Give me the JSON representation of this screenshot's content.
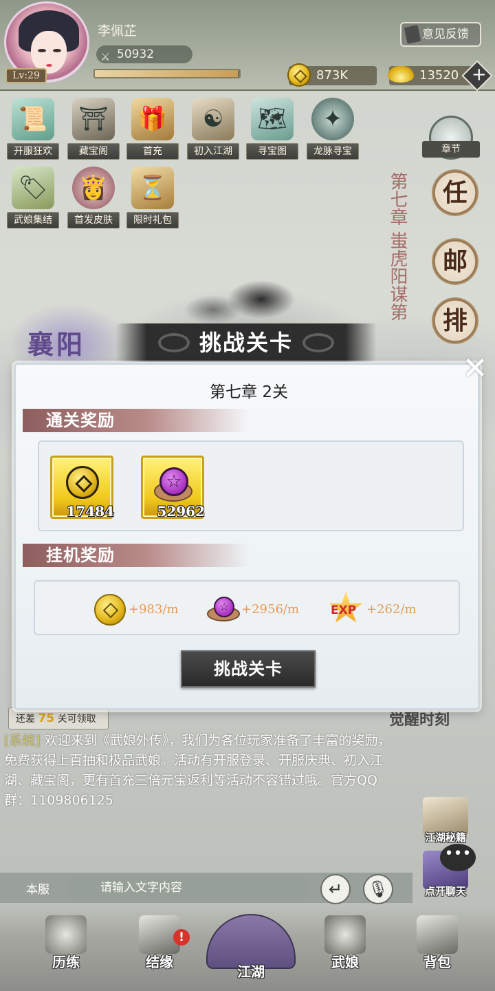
{
  "player": {
    "name": "李佩芷",
    "level": "Lv:29",
    "power": "50932",
    "exp_progress": 0.99
  },
  "header": {
    "feedback_label": "意见反馈",
    "gold": "873K",
    "ingot": "13520"
  },
  "activities": [
    {
      "label": "开服狂欢"
    },
    {
      "label": "藏宝阁"
    },
    {
      "label": "首充"
    },
    {
      "label": "初入江湖"
    },
    {
      "label": "寻宝图"
    },
    {
      "label": "龙脉寻宝"
    },
    {
      "label": "武娘集结"
    },
    {
      "label": "首发皮肤"
    },
    {
      "label": "限时礼包"
    }
  ],
  "side": {
    "chapter_label": "章节",
    "buttons": [
      "任",
      "邮",
      "排"
    ],
    "vertical_title": "第七章 蚩虎阳谋第"
  },
  "stage": {
    "banner_title": "挑战关卡",
    "region_text": "襄阳"
  },
  "modal": {
    "title": "第七章  2关",
    "clear_reward_header": "通关奖励",
    "clear_rewards": [
      {
        "icon": "gold-coin",
        "count": "17484"
      },
      {
        "icon": "purple-gem",
        "count": "52962"
      }
    ],
    "idle_reward_header": "挂机奖励",
    "idle_rewards": [
      {
        "icon": "gold-coin",
        "value": "+983/m"
      },
      {
        "icon": "purple-gem",
        "value": "+2956/m"
      },
      {
        "icon": "exp-star",
        "value": "+262/m",
        "icon_text": "EXP"
      }
    ],
    "challenge_label": "挑战关卡",
    "close_glyph": "✕"
  },
  "progress_hint": {
    "prefix": "还差",
    "number": "7",
    "number2": "5",
    "suffix": "关可领取"
  },
  "right_panel_text": "觉醒时刻",
  "chat": {
    "tag": "[系统]",
    "message": "欢迎来到《武娘外传》，我们为各位玩家准备了丰富的奖励，免费获得上百抽和极品武娘。活动有开服登录、开服庆典、初入江湖、藏宝阁，更有首充三倍元宝返利等活动不容错过哦。官方QQ群：1109806125",
    "server_label": "本服",
    "input_placeholder": "请输入文字内容",
    "secrets_label": "江湖秘籍",
    "open_chat_label": "点开聊天",
    "bubble": "•••"
  },
  "nav": {
    "items": [
      "历练",
      "结缘",
      "江湖",
      "武娘",
      "背包"
    ],
    "badge": "!"
  },
  "colors": {
    "accent_gold": "#d8a319",
    "idle_value": "#e79b54",
    "section_header": "#8e5d5d"
  }
}
